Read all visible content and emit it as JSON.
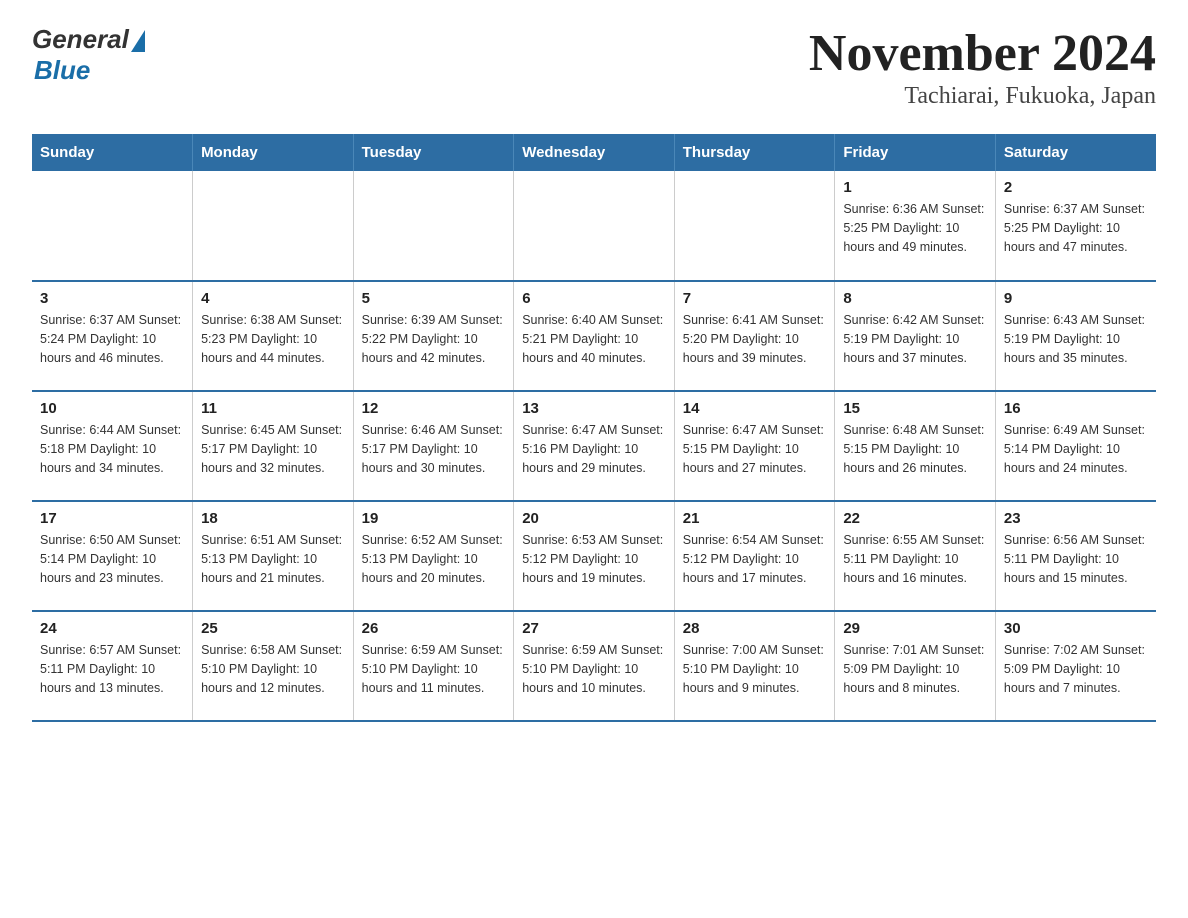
{
  "header": {
    "logo": {
      "general": "General",
      "blue": "Blue",
      "subtitle": "Blue"
    },
    "title": "November 2024",
    "subtitle": "Tachiarai, Fukuoka, Japan"
  },
  "days_of_week": [
    "Sunday",
    "Monday",
    "Tuesday",
    "Wednesday",
    "Thursday",
    "Friday",
    "Saturday"
  ],
  "weeks": [
    [
      {
        "day": "",
        "info": ""
      },
      {
        "day": "",
        "info": ""
      },
      {
        "day": "",
        "info": ""
      },
      {
        "day": "",
        "info": ""
      },
      {
        "day": "",
        "info": ""
      },
      {
        "day": "1",
        "info": "Sunrise: 6:36 AM\nSunset: 5:25 PM\nDaylight: 10 hours and 49 minutes."
      },
      {
        "day": "2",
        "info": "Sunrise: 6:37 AM\nSunset: 5:25 PM\nDaylight: 10 hours and 47 minutes."
      }
    ],
    [
      {
        "day": "3",
        "info": "Sunrise: 6:37 AM\nSunset: 5:24 PM\nDaylight: 10 hours and 46 minutes."
      },
      {
        "day": "4",
        "info": "Sunrise: 6:38 AM\nSunset: 5:23 PM\nDaylight: 10 hours and 44 minutes."
      },
      {
        "day": "5",
        "info": "Sunrise: 6:39 AM\nSunset: 5:22 PM\nDaylight: 10 hours and 42 minutes."
      },
      {
        "day": "6",
        "info": "Sunrise: 6:40 AM\nSunset: 5:21 PM\nDaylight: 10 hours and 40 minutes."
      },
      {
        "day": "7",
        "info": "Sunrise: 6:41 AM\nSunset: 5:20 PM\nDaylight: 10 hours and 39 minutes."
      },
      {
        "day": "8",
        "info": "Sunrise: 6:42 AM\nSunset: 5:19 PM\nDaylight: 10 hours and 37 minutes."
      },
      {
        "day": "9",
        "info": "Sunrise: 6:43 AM\nSunset: 5:19 PM\nDaylight: 10 hours and 35 minutes."
      }
    ],
    [
      {
        "day": "10",
        "info": "Sunrise: 6:44 AM\nSunset: 5:18 PM\nDaylight: 10 hours and 34 minutes."
      },
      {
        "day": "11",
        "info": "Sunrise: 6:45 AM\nSunset: 5:17 PM\nDaylight: 10 hours and 32 minutes."
      },
      {
        "day": "12",
        "info": "Sunrise: 6:46 AM\nSunset: 5:17 PM\nDaylight: 10 hours and 30 minutes."
      },
      {
        "day": "13",
        "info": "Sunrise: 6:47 AM\nSunset: 5:16 PM\nDaylight: 10 hours and 29 minutes."
      },
      {
        "day": "14",
        "info": "Sunrise: 6:47 AM\nSunset: 5:15 PM\nDaylight: 10 hours and 27 minutes."
      },
      {
        "day": "15",
        "info": "Sunrise: 6:48 AM\nSunset: 5:15 PM\nDaylight: 10 hours and 26 minutes."
      },
      {
        "day": "16",
        "info": "Sunrise: 6:49 AM\nSunset: 5:14 PM\nDaylight: 10 hours and 24 minutes."
      }
    ],
    [
      {
        "day": "17",
        "info": "Sunrise: 6:50 AM\nSunset: 5:14 PM\nDaylight: 10 hours and 23 minutes."
      },
      {
        "day": "18",
        "info": "Sunrise: 6:51 AM\nSunset: 5:13 PM\nDaylight: 10 hours and 21 minutes."
      },
      {
        "day": "19",
        "info": "Sunrise: 6:52 AM\nSunset: 5:13 PM\nDaylight: 10 hours and 20 minutes."
      },
      {
        "day": "20",
        "info": "Sunrise: 6:53 AM\nSunset: 5:12 PM\nDaylight: 10 hours and 19 minutes."
      },
      {
        "day": "21",
        "info": "Sunrise: 6:54 AM\nSunset: 5:12 PM\nDaylight: 10 hours and 17 minutes."
      },
      {
        "day": "22",
        "info": "Sunrise: 6:55 AM\nSunset: 5:11 PM\nDaylight: 10 hours and 16 minutes."
      },
      {
        "day": "23",
        "info": "Sunrise: 6:56 AM\nSunset: 5:11 PM\nDaylight: 10 hours and 15 minutes."
      }
    ],
    [
      {
        "day": "24",
        "info": "Sunrise: 6:57 AM\nSunset: 5:11 PM\nDaylight: 10 hours and 13 minutes."
      },
      {
        "day": "25",
        "info": "Sunrise: 6:58 AM\nSunset: 5:10 PM\nDaylight: 10 hours and 12 minutes."
      },
      {
        "day": "26",
        "info": "Sunrise: 6:59 AM\nSunset: 5:10 PM\nDaylight: 10 hours and 11 minutes."
      },
      {
        "day": "27",
        "info": "Sunrise: 6:59 AM\nSunset: 5:10 PM\nDaylight: 10 hours and 10 minutes."
      },
      {
        "day": "28",
        "info": "Sunrise: 7:00 AM\nSunset: 5:10 PM\nDaylight: 10 hours and 9 minutes."
      },
      {
        "day": "29",
        "info": "Sunrise: 7:01 AM\nSunset: 5:09 PM\nDaylight: 10 hours and 8 minutes."
      },
      {
        "day": "30",
        "info": "Sunrise: 7:02 AM\nSunset: 5:09 PM\nDaylight: 10 hours and 7 minutes."
      }
    ]
  ]
}
